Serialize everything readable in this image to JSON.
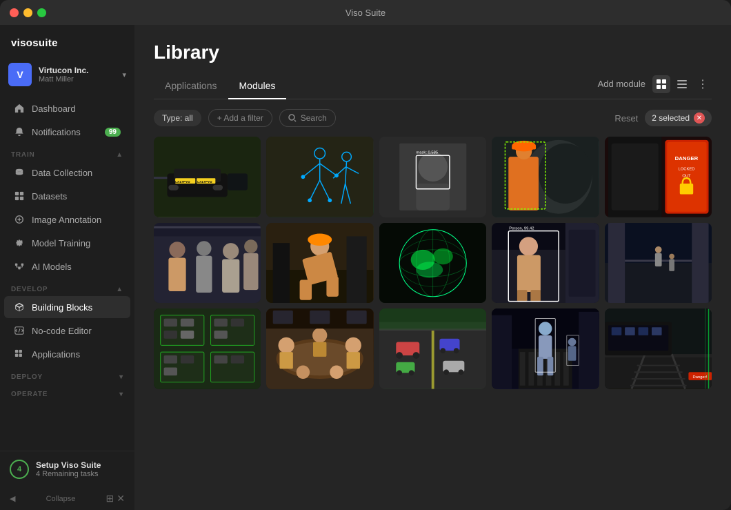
{
  "titlebar": {
    "title": "Viso Suite"
  },
  "sidebar": {
    "brand": "visosuite",
    "account": {
      "initial": "V",
      "company": "Virtucon Inc.",
      "user": "Matt Miller"
    },
    "nav": [
      {
        "id": "dashboard",
        "label": "Dashboard",
        "icon": "home-icon",
        "active": false
      },
      {
        "id": "notifications",
        "label": "Notifications",
        "icon": "bell-icon",
        "badge": "99",
        "active": false
      }
    ],
    "sections": [
      {
        "id": "train",
        "label": "TRAIN",
        "items": [
          {
            "id": "data-collection",
            "label": "Data Collection",
            "icon": "database-icon",
            "active": false
          },
          {
            "id": "datasets",
            "label": "Datasets",
            "icon": "grid-icon",
            "active": false
          },
          {
            "id": "image-annotation",
            "label": "Image Annotation",
            "icon": "annotation-icon",
            "active": false
          },
          {
            "id": "model-training",
            "label": "Model Training",
            "icon": "settings-icon",
            "active": false
          },
          {
            "id": "ai-models",
            "label": "AI Models",
            "icon": "models-icon",
            "active": false
          }
        ]
      },
      {
        "id": "develop",
        "label": "DEVELOP",
        "items": [
          {
            "id": "building-blocks",
            "label": "Building Blocks",
            "icon": "cube-icon",
            "active": true
          },
          {
            "id": "no-code-editor",
            "label": "No-code Editor",
            "icon": "nocode-icon",
            "active": false
          },
          {
            "id": "applications",
            "label": "Applications",
            "icon": "apps-icon",
            "active": false
          }
        ]
      },
      {
        "id": "deploy",
        "label": "DEPLOY",
        "items": []
      },
      {
        "id": "operate",
        "label": "OPERATE",
        "items": []
      }
    ],
    "setup": {
      "count": "4",
      "title": "Setup Viso Suite",
      "subtitle": "4 Remaining tasks"
    },
    "collapse_label": "Collapse"
  },
  "main": {
    "page_title": "Library",
    "tabs": [
      {
        "id": "applications",
        "label": "Applications",
        "active": false
      },
      {
        "id": "modules",
        "label": "Modules",
        "active": true
      }
    ],
    "toolbar": {
      "add_module": "Add module"
    },
    "filters": {
      "type_label": "Type: all",
      "add_filter": "+ Add a filter",
      "search": "Search",
      "reset": "Reset",
      "selected": "2 selected"
    },
    "grid": {
      "cards": [
        {
          "id": "card-1",
          "type": "car",
          "scene": "car-scene"
        },
        {
          "id": "card-2",
          "type": "skeleton",
          "scene": "skeleton-scene"
        },
        {
          "id": "card-3",
          "type": "face",
          "scene": "face-detect-scene"
        },
        {
          "id": "card-4",
          "type": "hardhat",
          "scene": "hardhat-scene"
        },
        {
          "id": "card-5",
          "type": "danger",
          "scene": "danger-scene"
        },
        {
          "id": "card-6",
          "type": "people-group",
          "scene": "people-group-scene"
        },
        {
          "id": "card-7",
          "type": "worker",
          "scene": "worker-scene"
        },
        {
          "id": "card-8",
          "type": "globe",
          "scene": "globe-scene"
        },
        {
          "id": "card-9",
          "type": "person-large",
          "scene": "person-large-scene"
        },
        {
          "id": "card-10",
          "type": "warehouse",
          "scene": "warehouse-scene"
        },
        {
          "id": "card-11",
          "type": "parking",
          "scene": "parking-scene"
        },
        {
          "id": "card-12",
          "type": "meeting",
          "scene": "meeting-scene"
        },
        {
          "id": "card-13",
          "type": "highway",
          "scene": "highway-scene"
        },
        {
          "id": "card-14",
          "type": "pedestrian",
          "scene": "pedestrian-scene"
        },
        {
          "id": "card-15",
          "type": "rail",
          "scene": "rail-scene"
        }
      ]
    }
  },
  "colors": {
    "accent_green": "#4caf50",
    "accent_blue": "#4a6cf7",
    "badge_red": "#e05555",
    "bg_sidebar": "#1e1e1e",
    "bg_main": "#252525",
    "text_primary": "#ffffff",
    "text_secondary": "#888888"
  }
}
